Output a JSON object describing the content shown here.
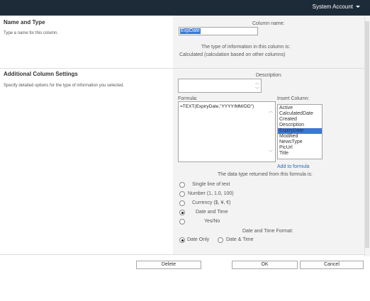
{
  "topbar": {
    "account_label": "System Account"
  },
  "name_type": {
    "heading": "Name and Type",
    "description": "Type a name for this column.",
    "column_name_label": "Column name:",
    "column_name_value": "ExpDate",
    "type_info_label": "The type of information in this column is:",
    "type_value": "Calculated (calculation based on other columns)"
  },
  "additional": {
    "heading": "Additional Column Settings",
    "description": "Specify detailed options for the type of information you selected.",
    "description_label": "Description:",
    "formula_label": "Formula:",
    "formula_value": "=TEXT(ExpiryDate,\"YYYY/MM/DD\")",
    "insert_column_label": "Insert Column:",
    "insert_items": [
      "Active",
      "CalculatedDate",
      "Created",
      "Description",
      "ExpiryDate",
      "Modified",
      "NewsType",
      "PicUrl",
      "Title"
    ],
    "insert_selected_index": 4,
    "add_to_formula": "Add to formula",
    "return_type_label": "The data type returned from this formula is:",
    "return_types": [
      "Single line of text",
      "Number (1, 1.0, 100)",
      "Currency ($, ¥, €)",
      "Date and Time",
      "Yes/No"
    ],
    "return_selected_index": 3,
    "datetime_format_label": "Date and Time Format:",
    "datetime_options": [
      "Date Only",
      "Date & Time"
    ],
    "datetime_selected_index": 0
  },
  "buttons": {
    "delete": "Delete",
    "ok": "OK",
    "cancel": "Cancel"
  }
}
